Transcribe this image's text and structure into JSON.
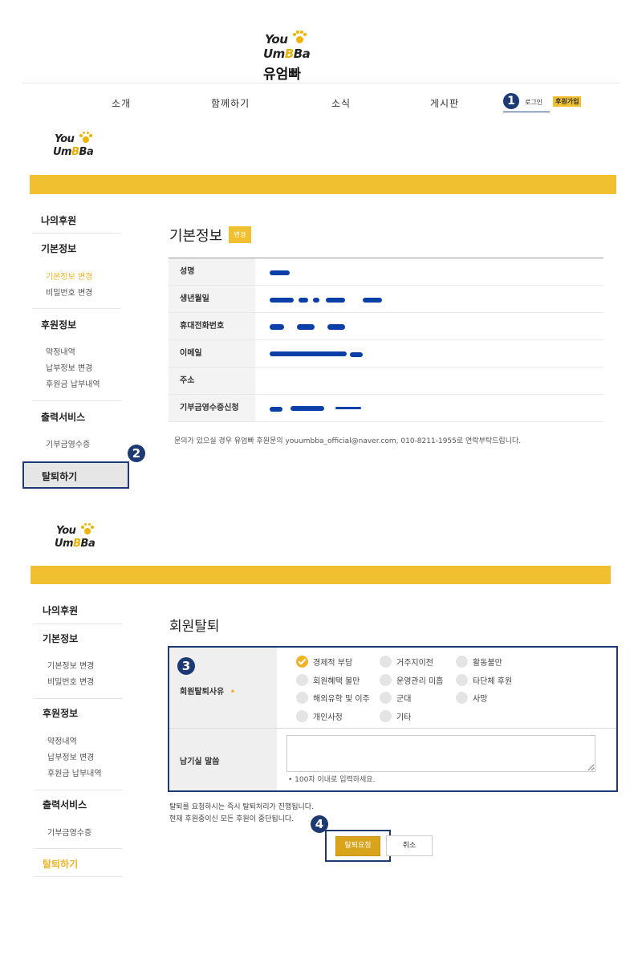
{
  "header": {
    "logo_you": "You",
    "logo_umba_prefix": "Um",
    "logo_umba_hl": "B",
    "logo_umba_suffix": "Ba",
    "logo_korean": "유엄빠",
    "nav": [
      "소개",
      "함께하기",
      "소식",
      "게시판"
    ],
    "login_label": "로그인",
    "join_label": "후원가입"
  },
  "badges": [
    "1",
    "2",
    "3",
    "4"
  ],
  "colors": {
    "accent": "#f0c030",
    "highlight_box": "#1e3a73",
    "active_link": "#f0b428"
  },
  "sidebar": {
    "my_sponsor": "나의후원",
    "basic_info": "기본정보",
    "basic_change": "기본정보 변경",
    "password_change": "비밀번호 변경",
    "sponsor_info": "후원정보",
    "pledge_history": "약정내역",
    "payment_change": "납부정보 변경",
    "payment_history": "후원금 납부내역",
    "print_service": "출력서비스",
    "receipt": "기부금영수증",
    "withdraw": "탈퇴하기"
  },
  "info": {
    "title": "기본정보",
    "change_btn": "변경",
    "rows": [
      "성명",
      "생년월일",
      "휴대전화번호",
      "이메일",
      "주소",
      "기부금영수증신청"
    ],
    "notice": "문의가 있으실 경우 유엄빠 후원문의 youumbba_official@naver.com, 010-8211-1955로 연락부탁드립니다."
  },
  "withdraw": {
    "title": "회원탈퇴",
    "reason_label": "회원탈퇴사유",
    "required_mark": "•",
    "reasons": [
      {
        "label": "경제적 부담",
        "checked": true
      },
      {
        "label": "거주지이전",
        "checked": false
      },
      {
        "label": "활동불만",
        "checked": false
      },
      {
        "label": "회원혜택 불만",
        "checked": false
      },
      {
        "label": "운영관리 미흡",
        "checked": false
      },
      {
        "label": "타단체 후원",
        "checked": false
      },
      {
        "label": "해외유학 및 이주",
        "checked": false
      },
      {
        "label": "군대",
        "checked": false
      },
      {
        "label": "사망",
        "checked": false
      },
      {
        "label": "개인사정",
        "checked": false
      },
      {
        "label": "기타",
        "checked": false
      }
    ],
    "comment_label": "남기실 말씀",
    "comment_value": "",
    "comment_hint": "• 100자 이내로 입력하세요.",
    "notice_1": "탈퇴를 요청하시는 즉시 탈퇴처리가 진행됩니다.",
    "notice_2": "현재 후원중이신 모든 후원이 중단됩니다.",
    "submit_label": "탈퇴요청",
    "cancel_label": "취소"
  }
}
